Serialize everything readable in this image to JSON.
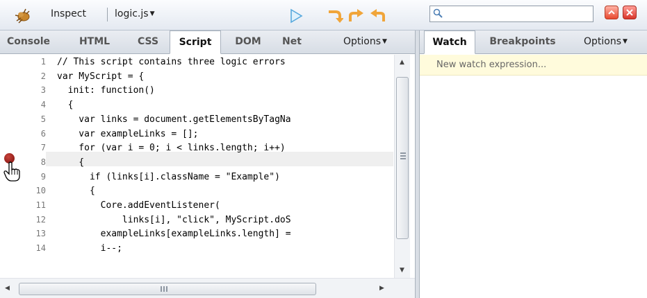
{
  "toolbar": {
    "inspect_label": "Inspect",
    "file_label": "logic.js",
    "icons": [
      "firebug-icon",
      "continue-icon",
      "step-over-icon",
      "step-into-icon",
      "step-out-icon",
      "search-icon"
    ],
    "search_value": ""
  },
  "script_tabs": [
    {
      "label": "Console",
      "active": false
    },
    {
      "label": "HTML",
      "active": false
    },
    {
      "label": "CSS",
      "active": false
    },
    {
      "label": "Script",
      "active": true
    },
    {
      "label": "DOM",
      "active": false
    },
    {
      "label": "Net",
      "active": false
    }
  ],
  "script_options": "Options",
  "side_tabs": [
    {
      "label": "Watch",
      "active": true
    },
    {
      "label": "Breakpoints",
      "active": false
    }
  ],
  "side_options": "Options",
  "watch": {
    "placeholder": "New watch expression..."
  },
  "code": {
    "line_numbers": [
      "1",
      "2",
      "3",
      "4",
      "5",
      "6",
      "7",
      "8",
      "9",
      "10",
      "11",
      "12",
      "13",
      "14"
    ],
    "lines": [
      "// This script contains three logic errors",
      "var MyScript = {",
      "  init: function()",
      "  {",
      "    var links = document.getElementsByTagNa",
      "    var exampleLinks = [];",
      "    for (var i = 0; i < links.length; i++)",
      "    {",
      "      if (links[i].className = \"Example\")",
      "      {",
      "        Core.addEventListener(",
      "            links[i], \"click\", MyScript.doS",
      "        exampleLinks[exampleLinks.length] =",
      "        i--;"
    ],
    "breakpoint_line": "7"
  },
  "colors": {
    "accent_blue": "#7ec1ea",
    "accent_orange": "#f0a53a",
    "breakpoint": "#9a1b16",
    "watch_bg": "#fffbdc"
  }
}
